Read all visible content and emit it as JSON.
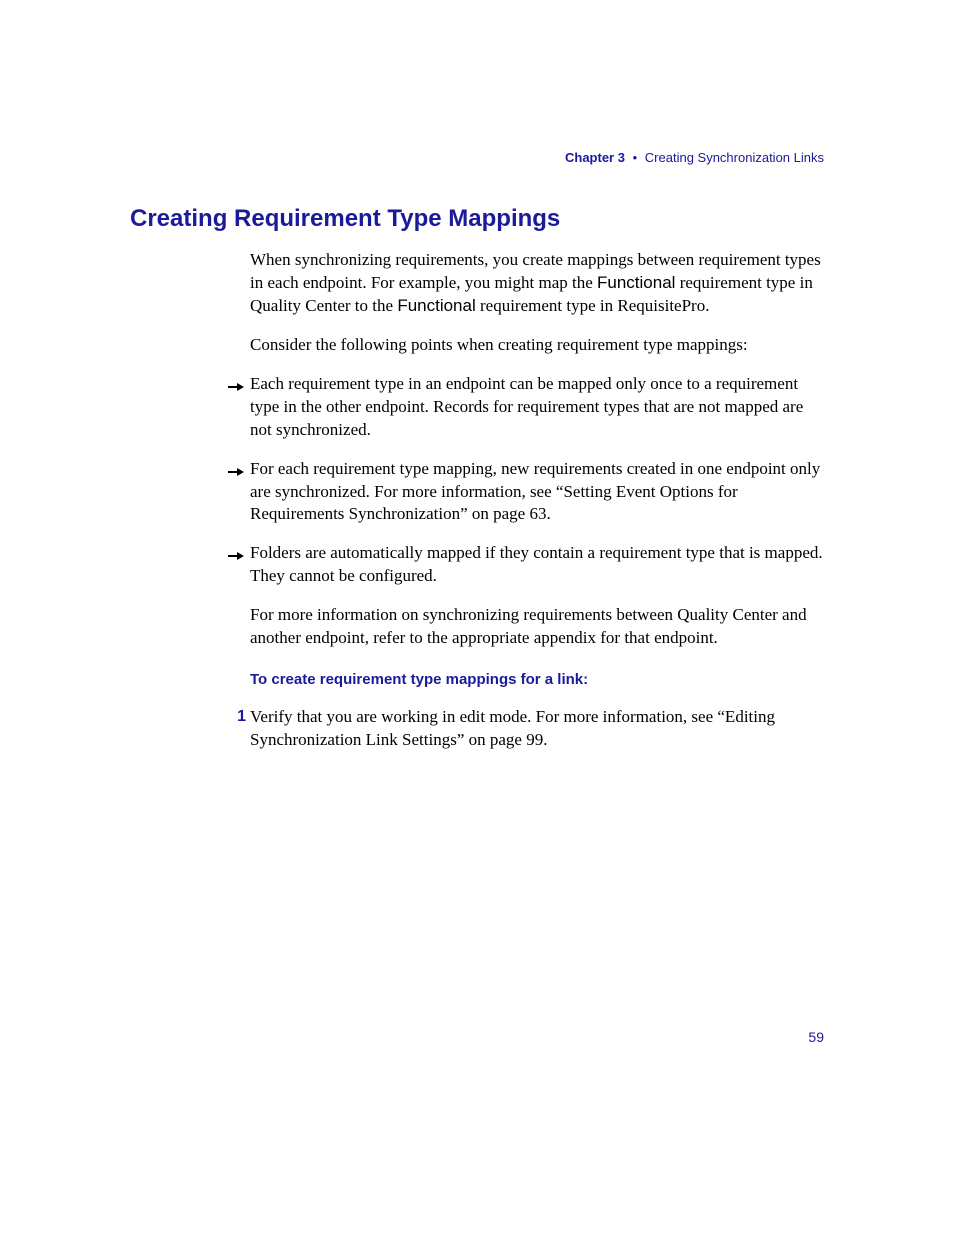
{
  "header": {
    "chapter_label": "Chapter 3",
    "bullet": "•",
    "chapter_title": "Creating Synchronization Links"
  },
  "title": "Creating Requirement Type Mappings",
  "intro": {
    "p1_a": "When synchronizing requirements, you create mappings between requirement types in each endpoint. For example, you might map the ",
    "p1_b": "Functional",
    "p1_c": " requirement type in Quality Center to the ",
    "p1_d": "Functional",
    "p1_e": " requirement type in RequisitePro.",
    "p2": "Consider the following points when creating requirement type mappings:"
  },
  "bullets": [
    "Each requirement type in an endpoint can be mapped only once to a requirement type in the other endpoint. Records for requirement types that are not mapped are not synchronized.",
    "For each requirement type mapping, new requirements created in one endpoint only are synchronized. For more information, see “Setting Event Options for Requirements Synchronization” on page 63.",
    "Folders are automatically mapped if they contain a requirement type that is mapped. They cannot be configured."
  ],
  "post_bullets": "For more information on synchronizing requirements between Quality Center and another endpoint, refer to the appropriate appendix for that endpoint.",
  "subhead": "To create requirement type mappings for a link:",
  "steps": [
    {
      "num": "1",
      "text": "Verify that you are working in edit mode. For more information, see “Editing Synchronization Link Settings” on page 99."
    }
  ],
  "page_number": "59"
}
